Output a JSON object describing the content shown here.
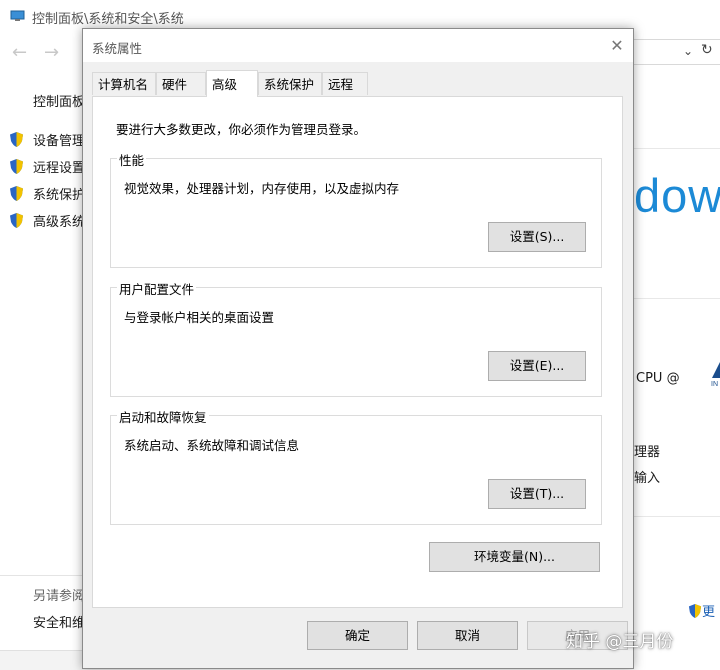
{
  "background_window": {
    "breadcrumb": "控制面板\\系统和安全\\系统",
    "left_panel": {
      "home_link": "控制面板",
      "links": [
        "设备管理",
        "远程设置",
        "系统保护",
        "高级系统"
      ],
      "see_also": "另请参阅",
      "security_link": "安全和维"
    },
    "right_panel": {
      "windows_logo_text": "dow",
      "cpu_text": "CPU @",
      "processor_text": "理器",
      "input_text": "输入",
      "change_settings_link": "更"
    }
  },
  "dialog": {
    "title": "系统属性",
    "close_glyph": "✕",
    "tabs": [
      {
        "label": "计算机名",
        "active": false
      },
      {
        "label": "硬件",
        "active": false
      },
      {
        "label": "高级",
        "active": true
      },
      {
        "label": "系统保护",
        "active": false
      },
      {
        "label": "远程",
        "active": false
      }
    ],
    "admin_note": "要进行大多数更改，你必须作为管理员登录。",
    "performance": {
      "title": "性能",
      "description": "视觉效果，处理器计划，内存使用，以及虚拟内存",
      "button": "设置(S)..."
    },
    "user_profiles": {
      "title": "用户配置文件",
      "description": "与登录帐户相关的桌面设置",
      "button": "设置(E)..."
    },
    "startup_recovery": {
      "title": "启动和故障恢复",
      "description": "系统启动、系统故障和调试信息",
      "button": "设置(T)..."
    },
    "env_vars_button": "环境变量(N)...",
    "ok_button": "确定",
    "cancel_button": "取消",
    "apply_button": "应用"
  },
  "watermark": "知乎 @三月份",
  "colors": {
    "accent_blue": "#1c8ad6",
    "dialog_bg": "#f0f0f0",
    "button_bg": "#e1e1e1",
    "button_border": "#adadad"
  }
}
